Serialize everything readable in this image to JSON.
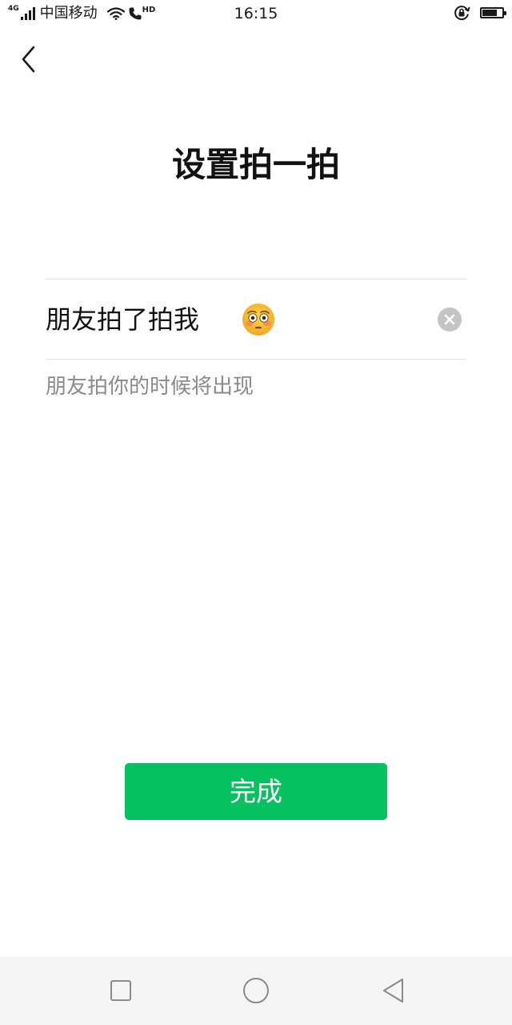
{
  "status_bar": {
    "network_type": "4G",
    "carrier": "中国移动",
    "hd_label": "HD",
    "time": "16:15",
    "battery_level": 0.75,
    "icons": [
      "signal-icon",
      "wifi-icon",
      "call-icon",
      "rotation-lock-icon",
      "battery-icon"
    ]
  },
  "header": {
    "back_icon": "chevron-left-icon",
    "title": "设置拍一拍"
  },
  "pat_field": {
    "value": "朋友拍了拍我",
    "emoji_icon": "flushed-emoji-icon",
    "clear_icon": "clear-icon",
    "hint": "朋友拍你的时候将出现"
  },
  "actions": {
    "done_label": "完成",
    "accent_color": "#07c160"
  },
  "nav_bar": {
    "icons": [
      "recent-apps-icon",
      "home-icon",
      "nav-back-icon"
    ]
  }
}
